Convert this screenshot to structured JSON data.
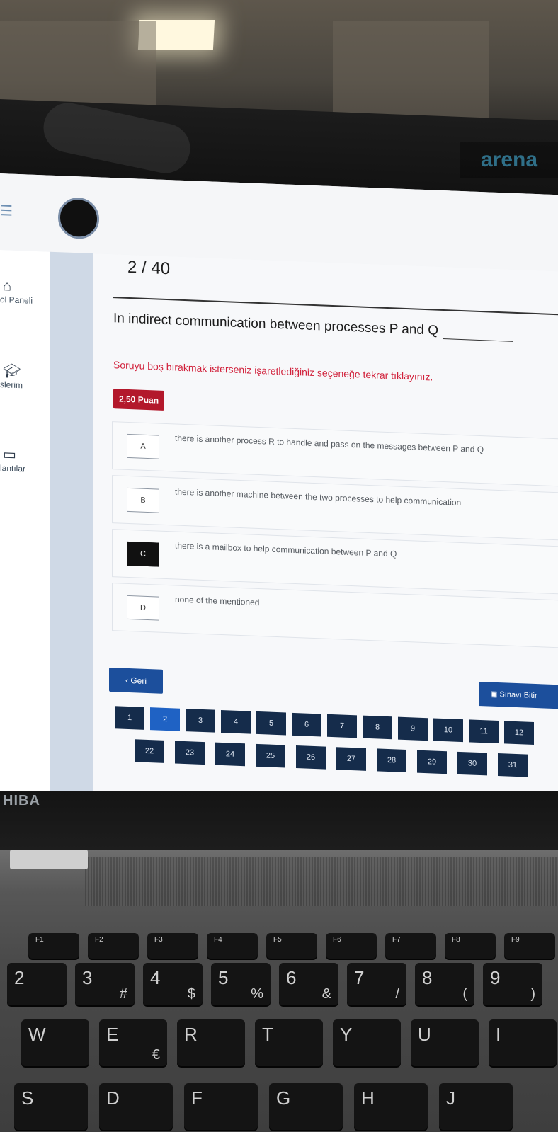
{
  "header": {
    "brand": "arena"
  },
  "sidebar": {
    "items": [
      {
        "label": "ol Paneli",
        "icon": "home-icon"
      },
      {
        "label": "slerim",
        "icon": "graduation-cap-icon"
      },
      {
        "label": "lantılar",
        "icon": "presentation-icon"
      }
    ]
  },
  "exam": {
    "counter": "2 / 40",
    "question": "In indirect communication between processes P and Q",
    "warning": "Soruyu boş bırakmak isterseniz işaretlediğiniz seçeneğe tekrar tıklayınız.",
    "points": "2,50 Puan",
    "selected_option": "C",
    "options": [
      {
        "letter": "A",
        "text": "there is another process R to handle and pass on the messages between P and Q"
      },
      {
        "letter": "B",
        "text": "there is another machine between the two processes to help communication"
      },
      {
        "letter": "C",
        "text": "there is a mailbox to help communication between P and Q"
      },
      {
        "letter": "D",
        "text": "none of the mentioned"
      }
    ],
    "back_label": "Geri",
    "finish_label": "Sınavı Bitir",
    "pages_row1": [
      "1",
      "2",
      "3",
      "4",
      "5",
      "6",
      "7",
      "8",
      "9",
      "10",
      "11",
      "12"
    ],
    "pages_row2": [
      "22",
      "23",
      "24",
      "25",
      "26",
      "27",
      "28",
      "29",
      "30",
      "31"
    ],
    "current_page": "2"
  },
  "laptop": {
    "brand_label": "HIBA",
    "keys": {
      "fn": [
        "F1",
        "F2",
        "F3",
        "F4",
        "F5",
        "F6",
        "F7",
        "F8",
        "F9"
      ],
      "numbers": [
        "2",
        "3 #",
        "4 $",
        "5 %",
        "6 &",
        "7 /",
        "8 (",
        "9 )"
      ],
      "qrow": [
        "W",
        "E €",
        "R",
        "T",
        "Y",
        "U",
        "I"
      ],
      "arow": [
        "S",
        "D",
        "F",
        "G",
        "H",
        "J"
      ]
    }
  },
  "colors": {
    "accent": "#1c4f9c",
    "points_badge": "#b3182b",
    "warning_text": "#d1213b",
    "pager_bg": "#152c4b"
  }
}
